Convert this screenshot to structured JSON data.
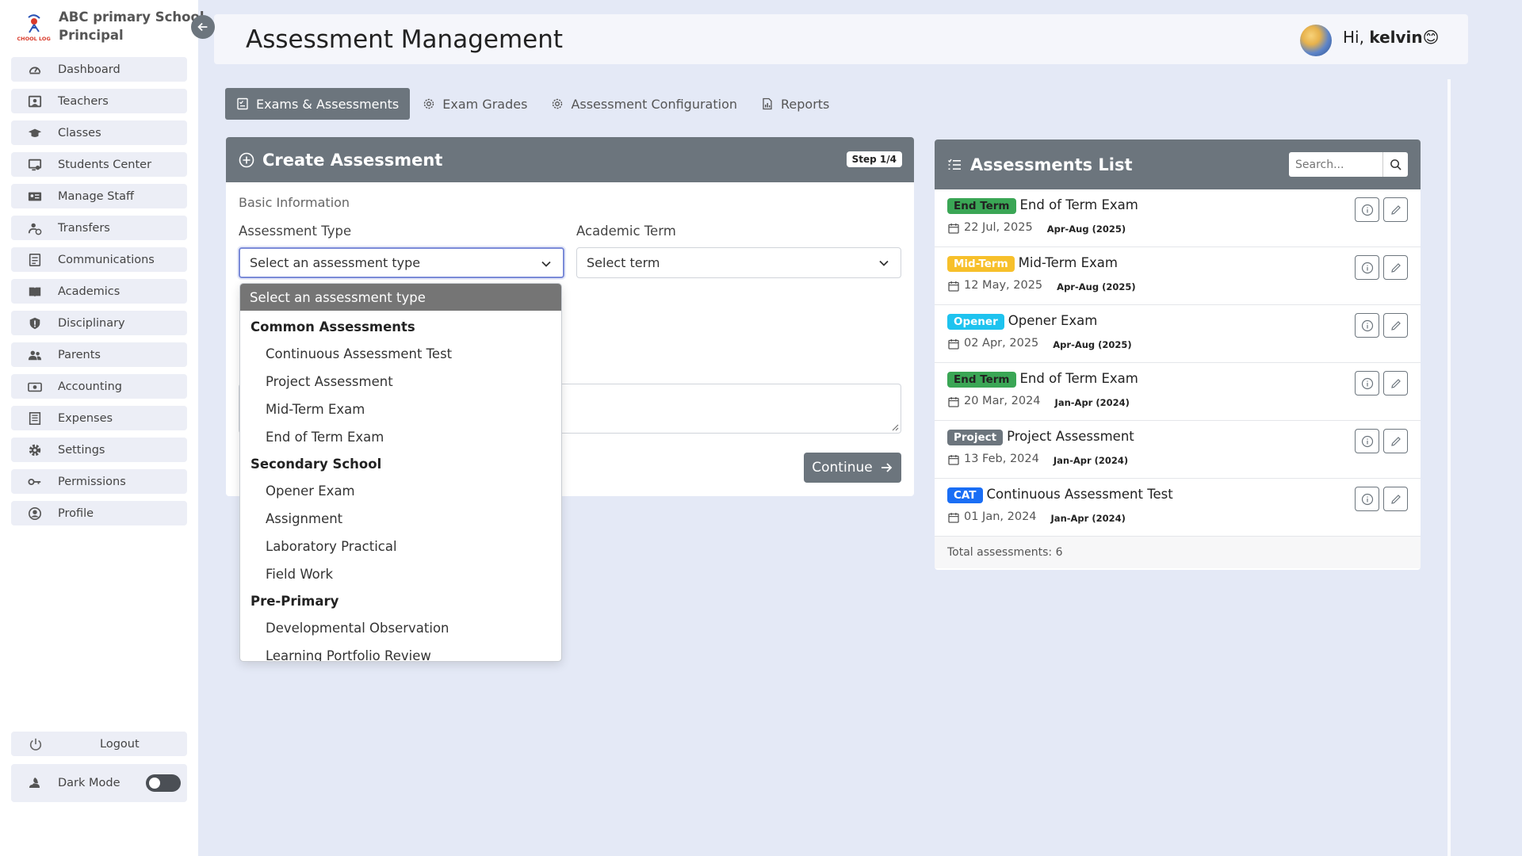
{
  "brand": {
    "name": "ABC primary School",
    "role": "Principal",
    "logo_text": "SCHOOL LOGO"
  },
  "sidebar": {
    "items": [
      {
        "label": "Dashboard",
        "icon": "dashboard-icon"
      },
      {
        "label": "Teachers",
        "icon": "teacher-icon"
      },
      {
        "label": "Classes",
        "icon": "graduation-cap-icon"
      },
      {
        "label": "Students Center",
        "icon": "student-icon"
      },
      {
        "label": "Manage Staff",
        "icon": "id-card-icon"
      },
      {
        "label": "Transfers",
        "icon": "transfer-icon"
      },
      {
        "label": "Communications",
        "icon": "list-icon"
      },
      {
        "label": "Academics",
        "icon": "book-icon"
      },
      {
        "label": "Disciplinary",
        "icon": "shield-icon"
      },
      {
        "label": "Parents",
        "icon": "users-icon"
      },
      {
        "label": "Accounting",
        "icon": "money-icon"
      },
      {
        "label": "Expenses",
        "icon": "receipt-icon"
      },
      {
        "label": "Settings",
        "icon": "gear-icon"
      },
      {
        "label": "Permissions",
        "icon": "key-icon"
      },
      {
        "label": "Profile",
        "icon": "user-circle-icon"
      }
    ],
    "logout_label": "Logout",
    "dark_mode_label": "Dark Mode",
    "dark_mode_on": false
  },
  "header": {
    "title": "Assessment Management",
    "greeting": "Hi,",
    "user": "kelvin",
    "emoji": "😊"
  },
  "tabs": [
    {
      "label": "Exams & Assessments",
      "active": true,
      "icon": "checklist-icon"
    },
    {
      "label": "Exam Grades",
      "active": false,
      "icon": "gear-icon"
    },
    {
      "label": "Assessment Configuration",
      "active": false,
      "icon": "gear-icon"
    },
    {
      "label": "Reports",
      "active": false,
      "icon": "report-icon"
    }
  ],
  "create": {
    "title": "Create Assessment",
    "step": "Step 1/4",
    "section": "Basic Information",
    "type_label": "Assessment Type",
    "type_value": "Select an assessment type",
    "term_label": "Academic Term",
    "term_value": "Select term",
    "continue_label": "Continue"
  },
  "dropdown": {
    "selected": "Select an assessment type",
    "groups": [
      {
        "label": "Common Assessments",
        "options": [
          "Continuous Assessment Test",
          "Project Assessment",
          "Mid-Term Exam",
          "End of Term Exam"
        ]
      },
      {
        "label": "Secondary School",
        "options": [
          "Opener Exam",
          "Assignment",
          "Laboratory Practical",
          "Field Work"
        ]
      },
      {
        "label": "Pre-Primary",
        "options": [
          "Developmental Observation",
          "Learning Portfolio Review"
        ]
      }
    ]
  },
  "list": {
    "title": "Assessments List",
    "search_placeholder": "Search...",
    "rows": [
      {
        "badge": "End Term",
        "badge_color": "#3aa655",
        "name": "End of Term Exam",
        "date": "22 Jul, 2025",
        "term": "Apr-Aug (2025)"
      },
      {
        "badge": "Mid-Term",
        "badge_color": "#f7c02b",
        "name": "Mid-Term Exam",
        "date": "12 May, 2025",
        "term": "Apr-Aug (2025)"
      },
      {
        "badge": "Opener",
        "badge_color": "#1ec3ef",
        "name": "Opener Exam",
        "date": "02 Apr, 2025",
        "term": "Apr-Aug (2025)"
      },
      {
        "badge": "End Term",
        "badge_color": "#3aa655",
        "name": "End of Term Exam",
        "date": "20 Mar, 2024",
        "term": "Jan-Apr (2024)"
      },
      {
        "badge": "Project",
        "badge_color": "#6c757d",
        "name": "Project Assessment",
        "date": "13 Feb, 2024",
        "term": "Jan-Apr (2024)"
      },
      {
        "badge": "CAT",
        "badge_color": "#1a6ef5",
        "name": "Continuous Assessment Test",
        "date": "01 Jan, 2024",
        "term": "Jan-Apr (2024)"
      }
    ],
    "footer": "Total assessments: 6"
  },
  "colors": {
    "primary_gray": "#6c757d",
    "page_bg": "#e4e9f6",
    "focus_border": "#7b8bd8"
  }
}
